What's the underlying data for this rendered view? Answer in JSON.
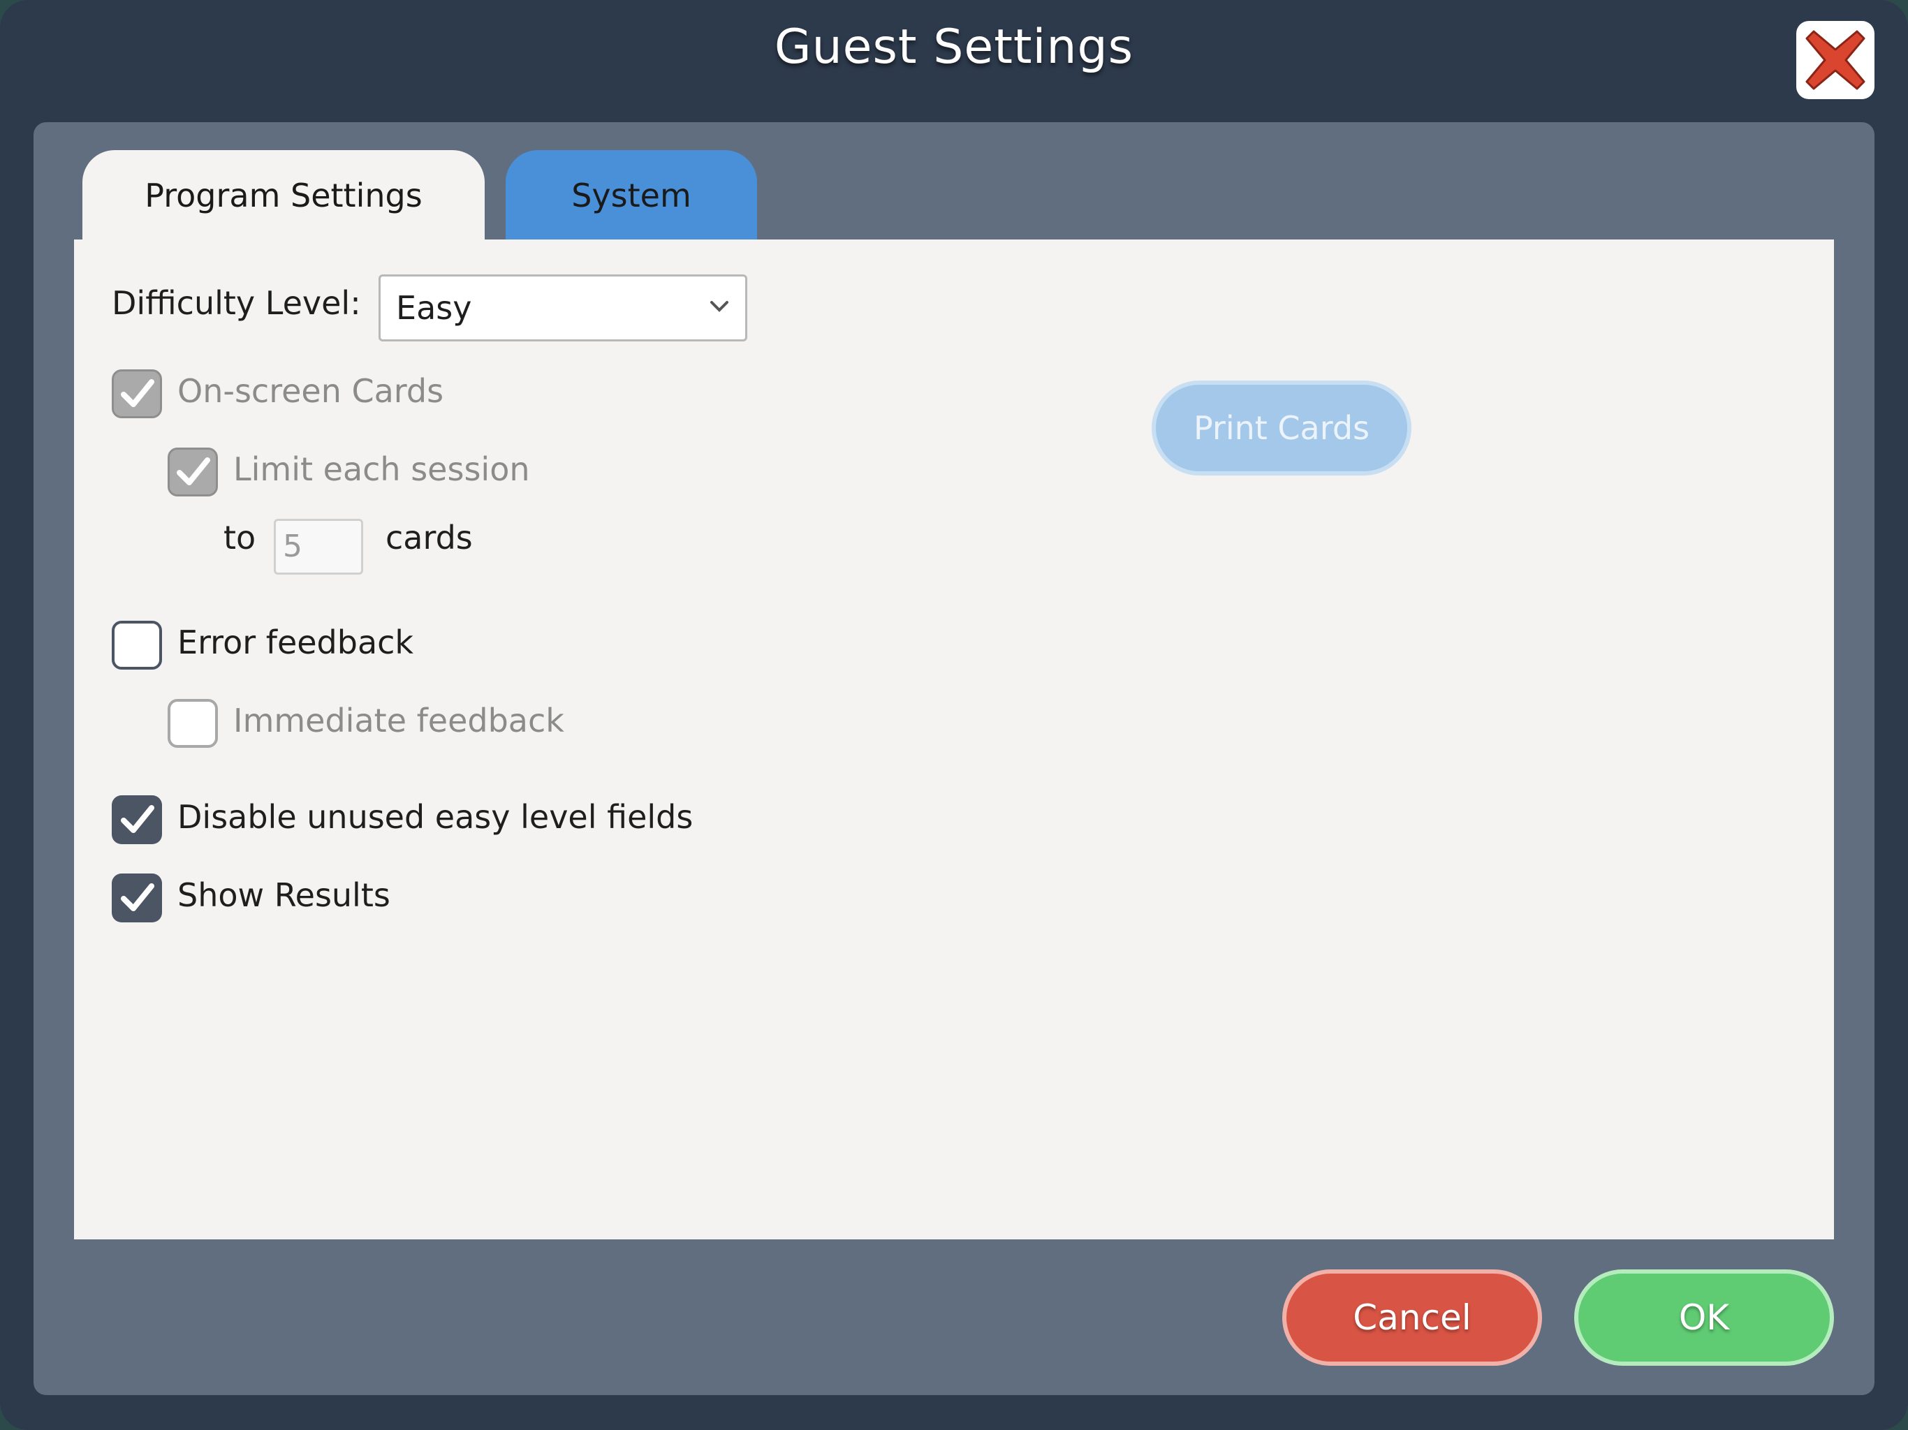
{
  "dialog": {
    "title": "Guest Settings",
    "close_icon": "close-x-icon"
  },
  "tabs": [
    {
      "label": "Program Settings",
      "active": true
    },
    {
      "label": "System",
      "active": false
    }
  ],
  "settings": {
    "difficulty_label": "Difficulty Level:",
    "difficulty_value": "Easy",
    "onscreen_cards_label": "On-screen Cards",
    "onscreen_cards_checked": true,
    "limit_session_label": "Limit each session",
    "limit_session_checked": true,
    "to_label": "to",
    "card_limit_value": "5",
    "cards_label": "cards",
    "error_feedback_label": "Error feedback",
    "error_feedback_checked": false,
    "immediate_feedback_label": "Immediate feedback",
    "immediate_feedback_checked": false,
    "disable_unused_label": "Disable unused easy level fields",
    "disable_unused_checked": true,
    "show_results_label": "Show Results",
    "show_results_checked": true
  },
  "buttons": {
    "print_cards": "Print Cards",
    "cancel": "Cancel",
    "ok": "OK"
  },
  "colors": {
    "cancel": "#d85444",
    "ok": "#5fcb72",
    "print_cards_disabled": "#a4c8ea",
    "system_tab": "#4a90d9",
    "close_x": "#d9452f"
  }
}
